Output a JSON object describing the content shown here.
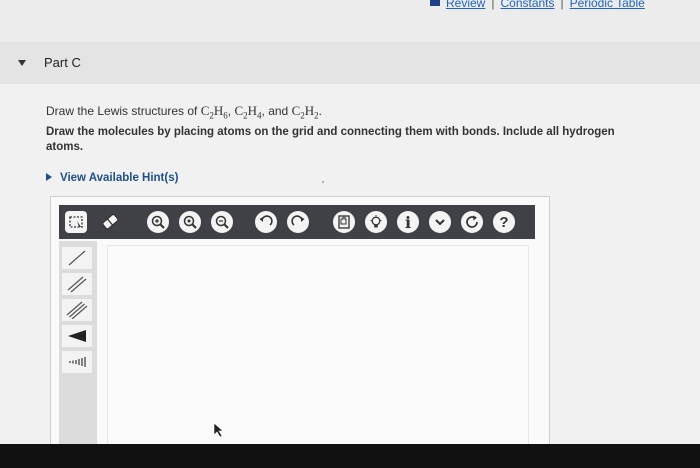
{
  "top_links": [
    "Review",
    "Constants",
    "Periodic Table"
  ],
  "part": {
    "title": "Part C"
  },
  "question": {
    "prefix": "Draw the Lewis structures of ",
    "f1_el1": "C",
    "f1_n1": "2",
    "f1_el2": "H",
    "f1_n2": "6",
    "sep1": ", ",
    "f2_el1": "C",
    "f2_n1": "2",
    "f2_el2": "H",
    "f2_n2": "4",
    "sep2": ", and ",
    "f3_el1": "C",
    "f3_n1": "2",
    "f3_el2": "H",
    "f3_n2": "2",
    "suffix": ".",
    "instruction": "Draw the molecules by placing atoms on the grid and connecting them with bonds. Include all hydrogen atoms."
  },
  "hints_label": "View Available Hint(s)",
  "toolbar": {
    "icons": [
      "selection-icon",
      "eraser-icon",
      "zoom-in-icon",
      "zoom-fit-icon",
      "zoom-out-icon",
      "undo-icon",
      "redo-icon",
      "template-icon",
      "lightbulb-icon",
      "info-icon",
      "expand-icon",
      "reset-icon",
      "help-icon"
    ],
    "info_glyph": "i",
    "help_glyph": "?"
  },
  "left_tools": [
    "single-bond-icon",
    "double-bond-icon",
    "triple-bond-icon",
    "wedge-bond-icon",
    "hash-bond-icon"
  ],
  "colors": {
    "accent": "#1e64c8",
    "toolbar": "#3f4147"
  }
}
